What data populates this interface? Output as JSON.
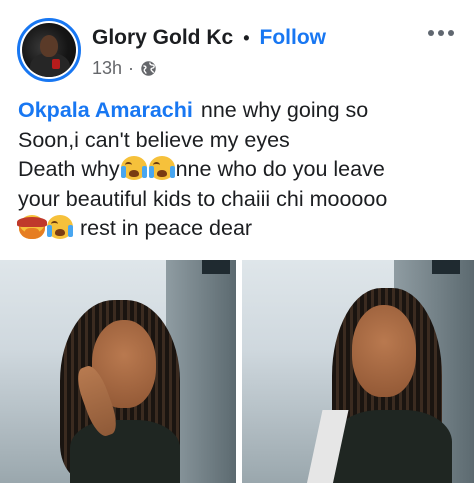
{
  "post": {
    "author": "Glory Gold Kc",
    "separator": "•",
    "follow_label": "Follow",
    "timestamp": "13h",
    "meta_separator": "·",
    "visibility_icon": "globe-icon",
    "more_icon": "more-options-icon",
    "mention": "Okpala Amarachi",
    "text_line1": "nne why going so",
    "text_line2": "Soon,i can't believe my eyes",
    "text_line3_a": "Death why",
    "text_line3_b": "nne who do you leave",
    "text_line4": "your beautiful kids to chaiii chi mooooo",
    "text_line5": "rest in peace dear",
    "emojis": [
      "loudly-crying-face",
      "loudly-crying-face",
      "facepalm",
      "loudly-crying-face"
    ],
    "accent_color": "#1877f2",
    "photos": [
      "woman-with-braids-photo-1",
      "woman-with-braids-photo-2"
    ]
  }
}
